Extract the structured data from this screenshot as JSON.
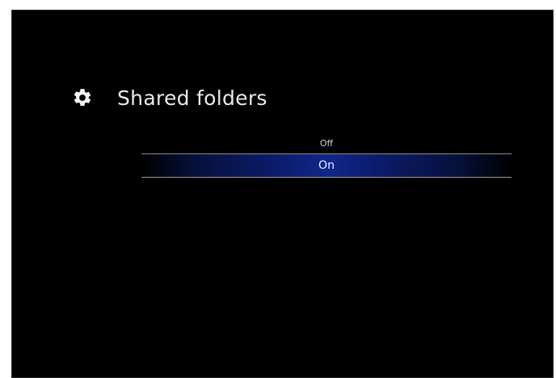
{
  "header": {
    "title": "Shared folders",
    "icon": "gear-icon"
  },
  "menu": {
    "options": [
      {
        "label": "Off",
        "selected": false
      },
      {
        "label": "On",
        "selected": true
      }
    ],
    "highlight_color": "#11268a"
  }
}
